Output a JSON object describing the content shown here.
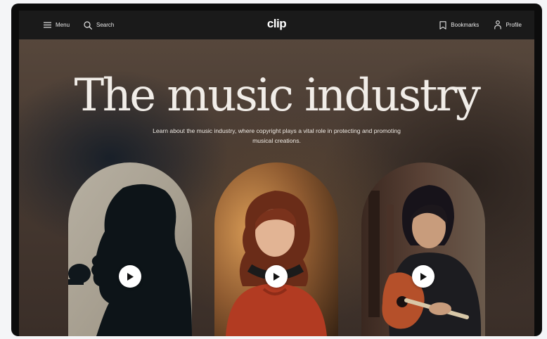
{
  "navbar": {
    "menu_label": "Menu",
    "search_label": "Search",
    "logo": "clip",
    "bookmarks_label": "Bookmarks",
    "profile_label": "Profile"
  },
  "hero": {
    "title": "The music industry",
    "subtitle": "Learn about the music industry, where copyright plays a vital role in protecting and promoting musical creations."
  },
  "videos": [
    {
      "subject": "singer-silhouette"
    },
    {
      "subject": "woman-with-headphones"
    },
    {
      "subject": "guitarist"
    }
  ],
  "icons": {
    "menu": "hamburger-icon",
    "search": "search-icon",
    "bookmarks": "bookmark-icon",
    "profile": "person-icon",
    "play": "play-icon"
  }
}
